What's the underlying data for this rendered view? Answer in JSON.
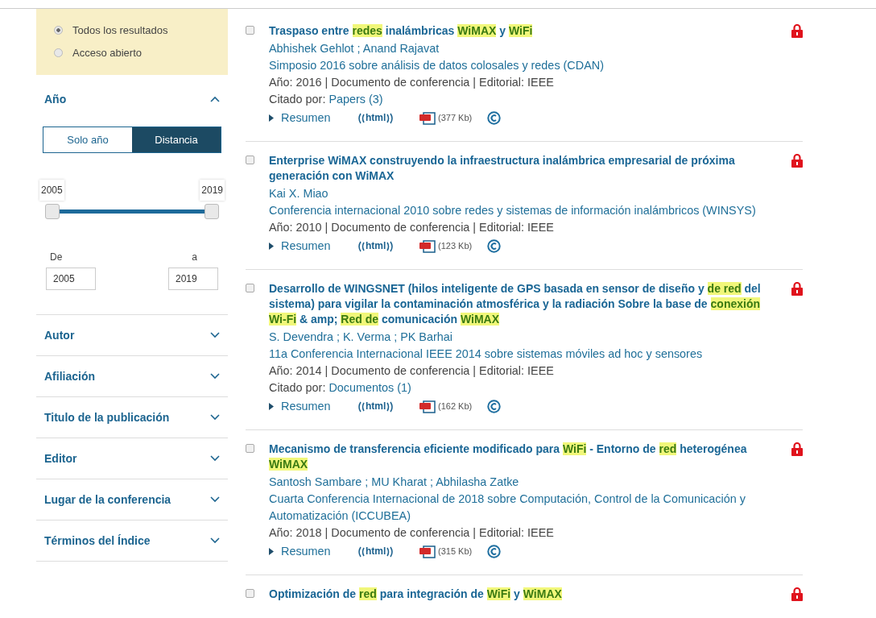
{
  "access_filter": {
    "options": [
      {
        "label": "Todos los resultados",
        "selected": true
      },
      {
        "label": "Acceso abierto",
        "selected": false
      }
    ]
  },
  "year_filter": {
    "title": "Año",
    "expanded": true,
    "modes": [
      {
        "label": "Solo año",
        "selected": false
      },
      {
        "label": "Distancia",
        "selected": true
      }
    ],
    "slider": {
      "min_label": "2005",
      "max_label": "2019",
      "thumbs": [
        {
          "level": 0
        },
        {
          "level": 1
        }
      ]
    },
    "from": {
      "label": "De",
      "value": "2005"
    },
    "to": {
      "label": "a",
      "value": "2019"
    }
  },
  "facets": [
    {
      "label": "Autor",
      "expanded": false
    },
    {
      "label": "Afiliación",
      "expanded": false
    },
    {
      "label": "Titulo de la publicación",
      "expanded": false
    },
    {
      "label": "Editor",
      "expanded": false
    },
    {
      "label": "Lugar de la conferencia",
      "expanded": false
    },
    {
      "label": "Términos del Índice",
      "expanded": false
    }
  ],
  "results": [
    {
      "checked": false,
      "locked": true,
      "title": [
        {
          "text": "Traspaso entre ",
          "highlight": false
        },
        {
          "text": "redes",
          "highlight": true
        },
        {
          "text": " inalámbricas ",
          "highlight": false
        },
        {
          "text": "WiMAX",
          "highlight": true
        },
        {
          "text": " y ",
          "highlight": false
        },
        {
          "text": "WiFi",
          "highlight": true
        }
      ],
      "authors": "Abhishek Gehlot ; Anand Rajavat",
      "venue": "Simposio 2016 sobre análisis de datos colosales y redes (CDAN)",
      "meta": "Año: 2016 | Documento de conferencia | Editorial: IEEE",
      "cited": {
        "prefix": "Citado por:",
        "link": "Papers (3)"
      },
      "abstract": "Resumen",
      "html": "html",
      "pdf_size": "(377 Kb)"
    },
    {
      "checked": false,
      "locked": true,
      "title": [
        {
          "text": "Enterprise WiMAX construyendo la infraestructura inalámbrica empresarial de próxima generación con WiMAX",
          "highlight": false
        }
      ],
      "authors": "Kai X. Miao",
      "venue": "Conferencia internacional 2010 sobre redes y sistemas de información inalámbricos (WINSYS)",
      "meta": "Año: 2010 | Documento de conferencia | Editorial: IEEE",
      "abstract": "Resumen",
      "html": "html",
      "pdf_size": "(123 Kb)"
    },
    {
      "checked": false,
      "locked": true,
      "title": [
        {
          "text": "Desarrollo de WINGSNET (hilos inteligente de GPS basada en sensor de diseño y ",
          "highlight": false
        },
        {
          "text": "de red",
          "highlight": true
        },
        {
          "text": " del sistema) para vigilar la contaminación atmosférica y la radiación Sobre la base de ",
          "highlight": false
        },
        {
          "text": "conexión Wi-Fi",
          "highlight": true
        },
        {
          "text": " & amp; ",
          "highlight": false
        },
        {
          "text": "Red de",
          "highlight": true
        },
        {
          "text": " comunicación ",
          "highlight": false
        },
        {
          "text": "WiMAX",
          "highlight": true
        }
      ],
      "authors": "S. Devendra ; K. Verma ; PK Barhai",
      "venue": "11a Conferencia Internacional IEEE 2014 sobre sistemas móviles ad hoc y sensores",
      "meta": "Año: 2014 | Documento de conferencia | Editorial: IEEE",
      "cited": {
        "prefix": "Citado por:",
        "link": "Documentos (1)"
      },
      "abstract": "Resumen",
      "html": "html",
      "pdf_size": "(162 Kb)"
    },
    {
      "checked": false,
      "locked": true,
      "title": [
        {
          "text": "Mecanismo de transferencia eficiente modificado para ",
          "highlight": false
        },
        {
          "text": "WiFi",
          "highlight": true
        },
        {
          "text": " - Entorno de ",
          "highlight": false
        },
        {
          "text": "red",
          "highlight": true
        },
        {
          "text": " heterogénea ",
          "highlight": false
        },
        {
          "text": "WiMAX",
          "highlight": true
        }
      ],
      "authors": "Santosh Sambare ; MU Kharat ; Abhilasha Zatke",
      "venue": "Cuarta Conferencia Internacional de 2018 sobre Computación, Control de la Comunicación y Automatización (ICCUBEA)",
      "meta": "Año: 2018 | Documento de conferencia | Editorial: IEEE",
      "abstract": "Resumen",
      "html": "html",
      "pdf_size": "(315 Kb)"
    },
    {
      "checked": false,
      "locked": true,
      "title": [
        {
          "text": "Optimización de ",
          "highlight": false
        },
        {
          "text": "red",
          "highlight": true
        },
        {
          "text": " para integración de ",
          "highlight": false
        },
        {
          "text": "WiFi",
          "highlight": true
        },
        {
          "text": " y ",
          "highlight": false
        },
        {
          "text": "WiMAX",
          "highlight": true
        }
      ]
    }
  ]
}
